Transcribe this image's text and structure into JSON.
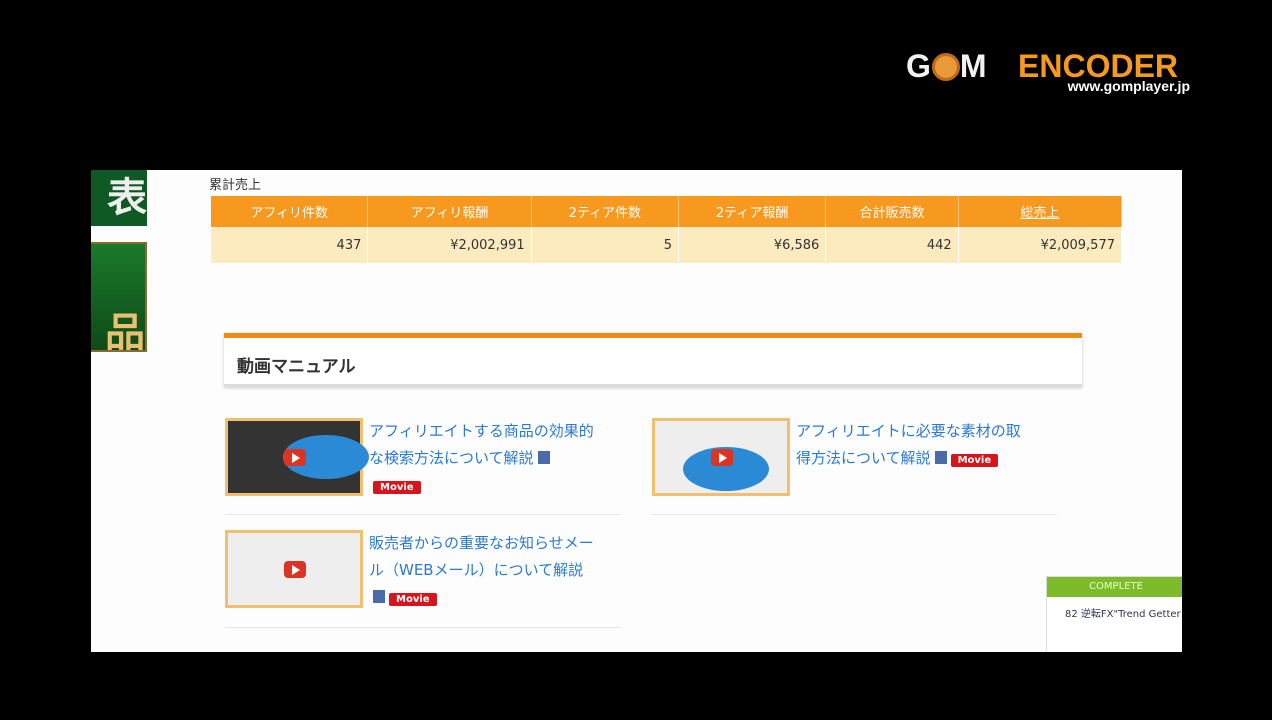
{
  "watermark": {
    "brand_left": "G",
    "brand_mid": "M",
    "brand_right": "ENCODER",
    "url": "www.gomplayer.jp"
  },
  "side_banners": [
    "表",
    "品"
  ],
  "sales": {
    "label": "累計売上",
    "headers": [
      "アフィリ件数",
      "アフィリ報酬",
      "2ティア件数",
      "2ティア報酬",
      "合計販売数",
      "総売上"
    ],
    "values": [
      "437",
      "¥2,002,991",
      "5",
      "¥6,586",
      "442",
      "¥2,009,577"
    ]
  },
  "manual": {
    "title": "動画マニュアル",
    "badge": "Movie",
    "items": [
      {
        "title": "アフィリエイトする商品の効果的な検索方法について解説"
      },
      {
        "title": "アフィリエイトに必要な素材の取得方法について解説"
      },
      {
        "title": "販売者からの重要なお知らせメール（WEBメール）について解説"
      }
    ]
  },
  "complete": {
    "header": "COMPLETE",
    "text": "82 逆転FX\"Trend Getter"
  }
}
